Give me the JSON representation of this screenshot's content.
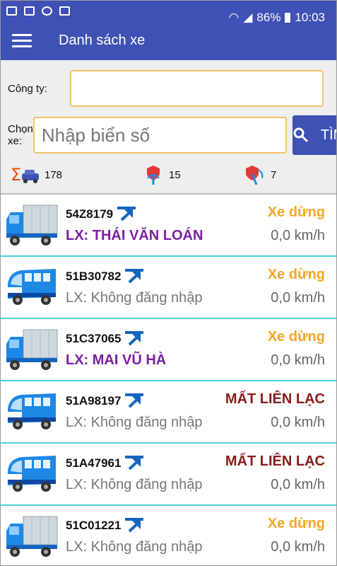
{
  "status_bar": {
    "battery": "86%",
    "time": "10:03"
  },
  "app_bar": {
    "title": "Danh sách xe"
  },
  "form": {
    "company_label": "Công ty:",
    "company_value": "",
    "vehicle_label": "Chọn xe:",
    "vehicle_placeholder": "Nhập biển số",
    "search_button": "TÌM"
  },
  "stats": {
    "total": "178",
    "signal": "15",
    "lost": "7"
  },
  "vehicles": [
    {
      "plate": "54Z8179",
      "driver": "LX: THÁI VĂN LOÁN",
      "status": "Xe dừng",
      "speed": "0,0 km/h",
      "type": "truck"
    },
    {
      "plate": "51B30782",
      "driver": "LX: Không đăng nhập",
      "status": "Xe dừng",
      "speed": "0,0 km/h",
      "type": "bus"
    },
    {
      "plate": "51C37065",
      "driver": "LX: MAI VŨ HÀ",
      "status": "Xe dừng",
      "speed": "0,0 km/h",
      "type": "truck"
    },
    {
      "plate": "51A98197",
      "driver": "LX: Không đăng nhập",
      "status": "MẤT LIÊN LẠC",
      "speed": "0,0 km/h",
      "type": "bus"
    },
    {
      "plate": "51A47961",
      "driver": "LX: Không đăng nhập",
      "status": "MẤT LIÊN LẠC",
      "speed": "0,0 km/h",
      "type": "bus"
    },
    {
      "plate": "51C01221",
      "driver": "LX: Không đăng nhập",
      "status": "Xe dừng",
      "speed": "0,0 km/h",
      "type": "truck"
    }
  ],
  "colors": {
    "primary": "#3f51b5",
    "stopped": "#f5a623",
    "lost": "#8b1a1a",
    "driver": "#7b1fa2",
    "divider": "#4dd0e1"
  }
}
